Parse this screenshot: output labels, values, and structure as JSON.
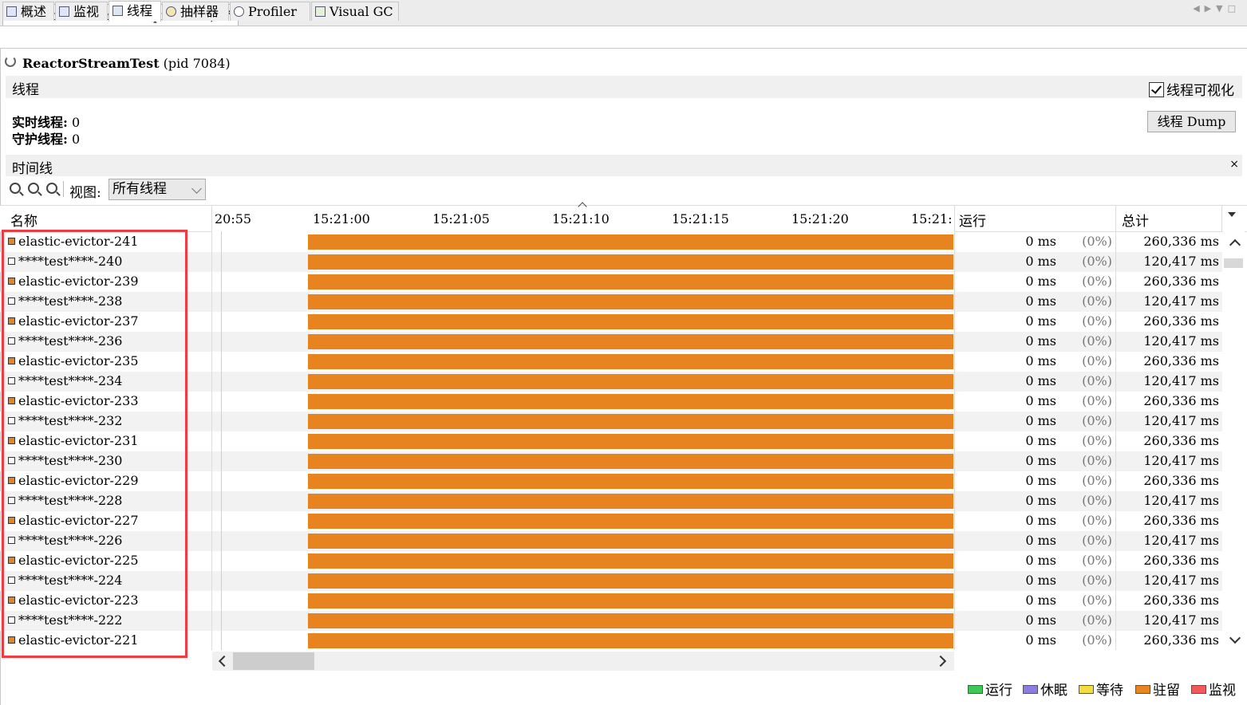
{
  "window": {
    "tab_title": "ReactorStreamTest (pid 7084)",
    "close_glyph": "×"
  },
  "subtabs": [
    {
      "label": "概述"
    },
    {
      "label": "监视"
    },
    {
      "label": "线程"
    },
    {
      "label": "抽样器"
    },
    {
      "label": "Profiler"
    },
    {
      "label": "Visual GC"
    }
  ],
  "header": {
    "app_name": "ReactorStreamTest",
    "pid": "(pid 7084)"
  },
  "threads_section": {
    "title": "线程",
    "visualize_label": "线程可视化",
    "visualize_checked": true,
    "live_label": "实时线程:",
    "live_value": "0",
    "daemon_label": "守护线程:",
    "daemon_value": "0",
    "dump_button": "线程 Dump"
  },
  "timeline_section": {
    "title": "时间线",
    "close_glyph": "×"
  },
  "toolbar": {
    "view_label": "视图:",
    "view_selected": "所有线程"
  },
  "columns": {
    "name": "名称",
    "running": "运行",
    "total": "总计"
  },
  "time_ticks": [
    "20:55",
    "15:21:00",
    "15:21:05",
    "15:21:10",
    "15:21:15",
    "15:21:20",
    "15:21:"
  ],
  "threads": [
    {
      "name": "elastic-evictor-241",
      "state": "park",
      "running": "0 ms",
      "pct": "(0%)",
      "total": "260,336 ms"
    },
    {
      "name": "****test****-240",
      "state": "none",
      "running": "0 ms",
      "pct": "(0%)",
      "total": "120,417 ms"
    },
    {
      "name": "elastic-evictor-239",
      "state": "park",
      "running": "0 ms",
      "pct": "(0%)",
      "total": "260,336 ms"
    },
    {
      "name": "****test****-238",
      "state": "none",
      "running": "0 ms",
      "pct": "(0%)",
      "total": "120,417 ms"
    },
    {
      "name": "elastic-evictor-237",
      "state": "park",
      "running": "0 ms",
      "pct": "(0%)",
      "total": "260,336 ms"
    },
    {
      "name": "****test****-236",
      "state": "none",
      "running": "0 ms",
      "pct": "(0%)",
      "total": "120,417 ms"
    },
    {
      "name": "elastic-evictor-235",
      "state": "park",
      "running": "0 ms",
      "pct": "(0%)",
      "total": "260,336 ms"
    },
    {
      "name": "****test****-234",
      "state": "none",
      "running": "0 ms",
      "pct": "(0%)",
      "total": "120,417 ms"
    },
    {
      "name": "elastic-evictor-233",
      "state": "park",
      "running": "0 ms",
      "pct": "(0%)",
      "total": "260,336 ms"
    },
    {
      "name": "****test****-232",
      "state": "none",
      "running": "0 ms",
      "pct": "(0%)",
      "total": "120,417 ms"
    },
    {
      "name": "elastic-evictor-231",
      "state": "park",
      "running": "0 ms",
      "pct": "(0%)",
      "total": "260,336 ms"
    },
    {
      "name": "****test****-230",
      "state": "none",
      "running": "0 ms",
      "pct": "(0%)",
      "total": "120,417 ms"
    },
    {
      "name": "elastic-evictor-229",
      "state": "park",
      "running": "0 ms",
      "pct": "(0%)",
      "total": "260,336 ms"
    },
    {
      "name": "****test****-228",
      "state": "none",
      "running": "0 ms",
      "pct": "(0%)",
      "total": "120,417 ms"
    },
    {
      "name": "elastic-evictor-227",
      "state": "park",
      "running": "0 ms",
      "pct": "(0%)",
      "total": "260,336 ms"
    },
    {
      "name": "****test****-226",
      "state": "none",
      "running": "0 ms",
      "pct": "(0%)",
      "total": "120,417 ms"
    },
    {
      "name": "elastic-evictor-225",
      "state": "park",
      "running": "0 ms",
      "pct": "(0%)",
      "total": "260,336 ms"
    },
    {
      "name": "****test****-224",
      "state": "none",
      "running": "0 ms",
      "pct": "(0%)",
      "total": "120,417 ms"
    },
    {
      "name": "elastic-evictor-223",
      "state": "park",
      "running": "0 ms",
      "pct": "(0%)",
      "total": "260,336 ms"
    },
    {
      "name": "****test****-222",
      "state": "none",
      "running": "0 ms",
      "pct": "(0%)",
      "total": "120,417 ms"
    },
    {
      "name": "elastic-evictor-221",
      "state": "park",
      "running": "0 ms",
      "pct": "(0%)",
      "total": "260,336 ms"
    }
  ],
  "legend": [
    {
      "label": "运行",
      "color": "#3ec957"
    },
    {
      "label": "休眠",
      "color": "#8c7ee0"
    },
    {
      "label": "等待",
      "color": "#f2dc3e"
    },
    {
      "label": "驻留",
      "color": "#e8851e"
    },
    {
      "label": "监视",
      "color": "#f05a5a"
    }
  ],
  "colors": {
    "park_bar": "#e88420",
    "highlight_box": "#f03c40"
  }
}
